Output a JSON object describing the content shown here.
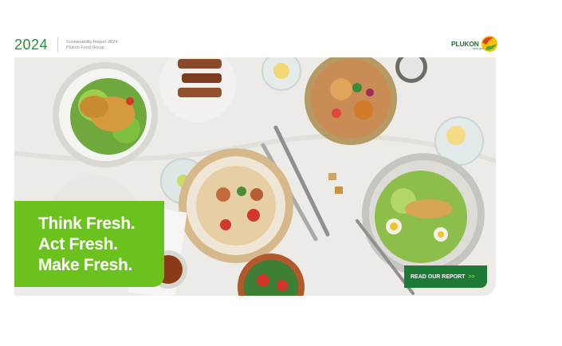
{
  "header": {
    "year": "2024",
    "subtitle_line1": "Sustainability Report 2024",
    "subtitle_line2": "Plukon Food Group"
  },
  "logo": {
    "name": "PLUKON",
    "tagline": "food group",
    "icon": "plukon-leaf-icon",
    "colors": {
      "red": "#e3392b",
      "yellow": "#f6c200",
      "green": "#4aa83d"
    }
  },
  "hero": {
    "image": "overhead photo of plated chicken dishes on a white tablecloth",
    "tagline": [
      "Think Fresh.",
      "Act Fresh.",
      "Make Fresh."
    ],
    "tagline_bg": "#6cc21d"
  },
  "cta": {
    "label": "READ OUR REPORT",
    "chevrons": ">>",
    "bg": "#1d7a36"
  }
}
